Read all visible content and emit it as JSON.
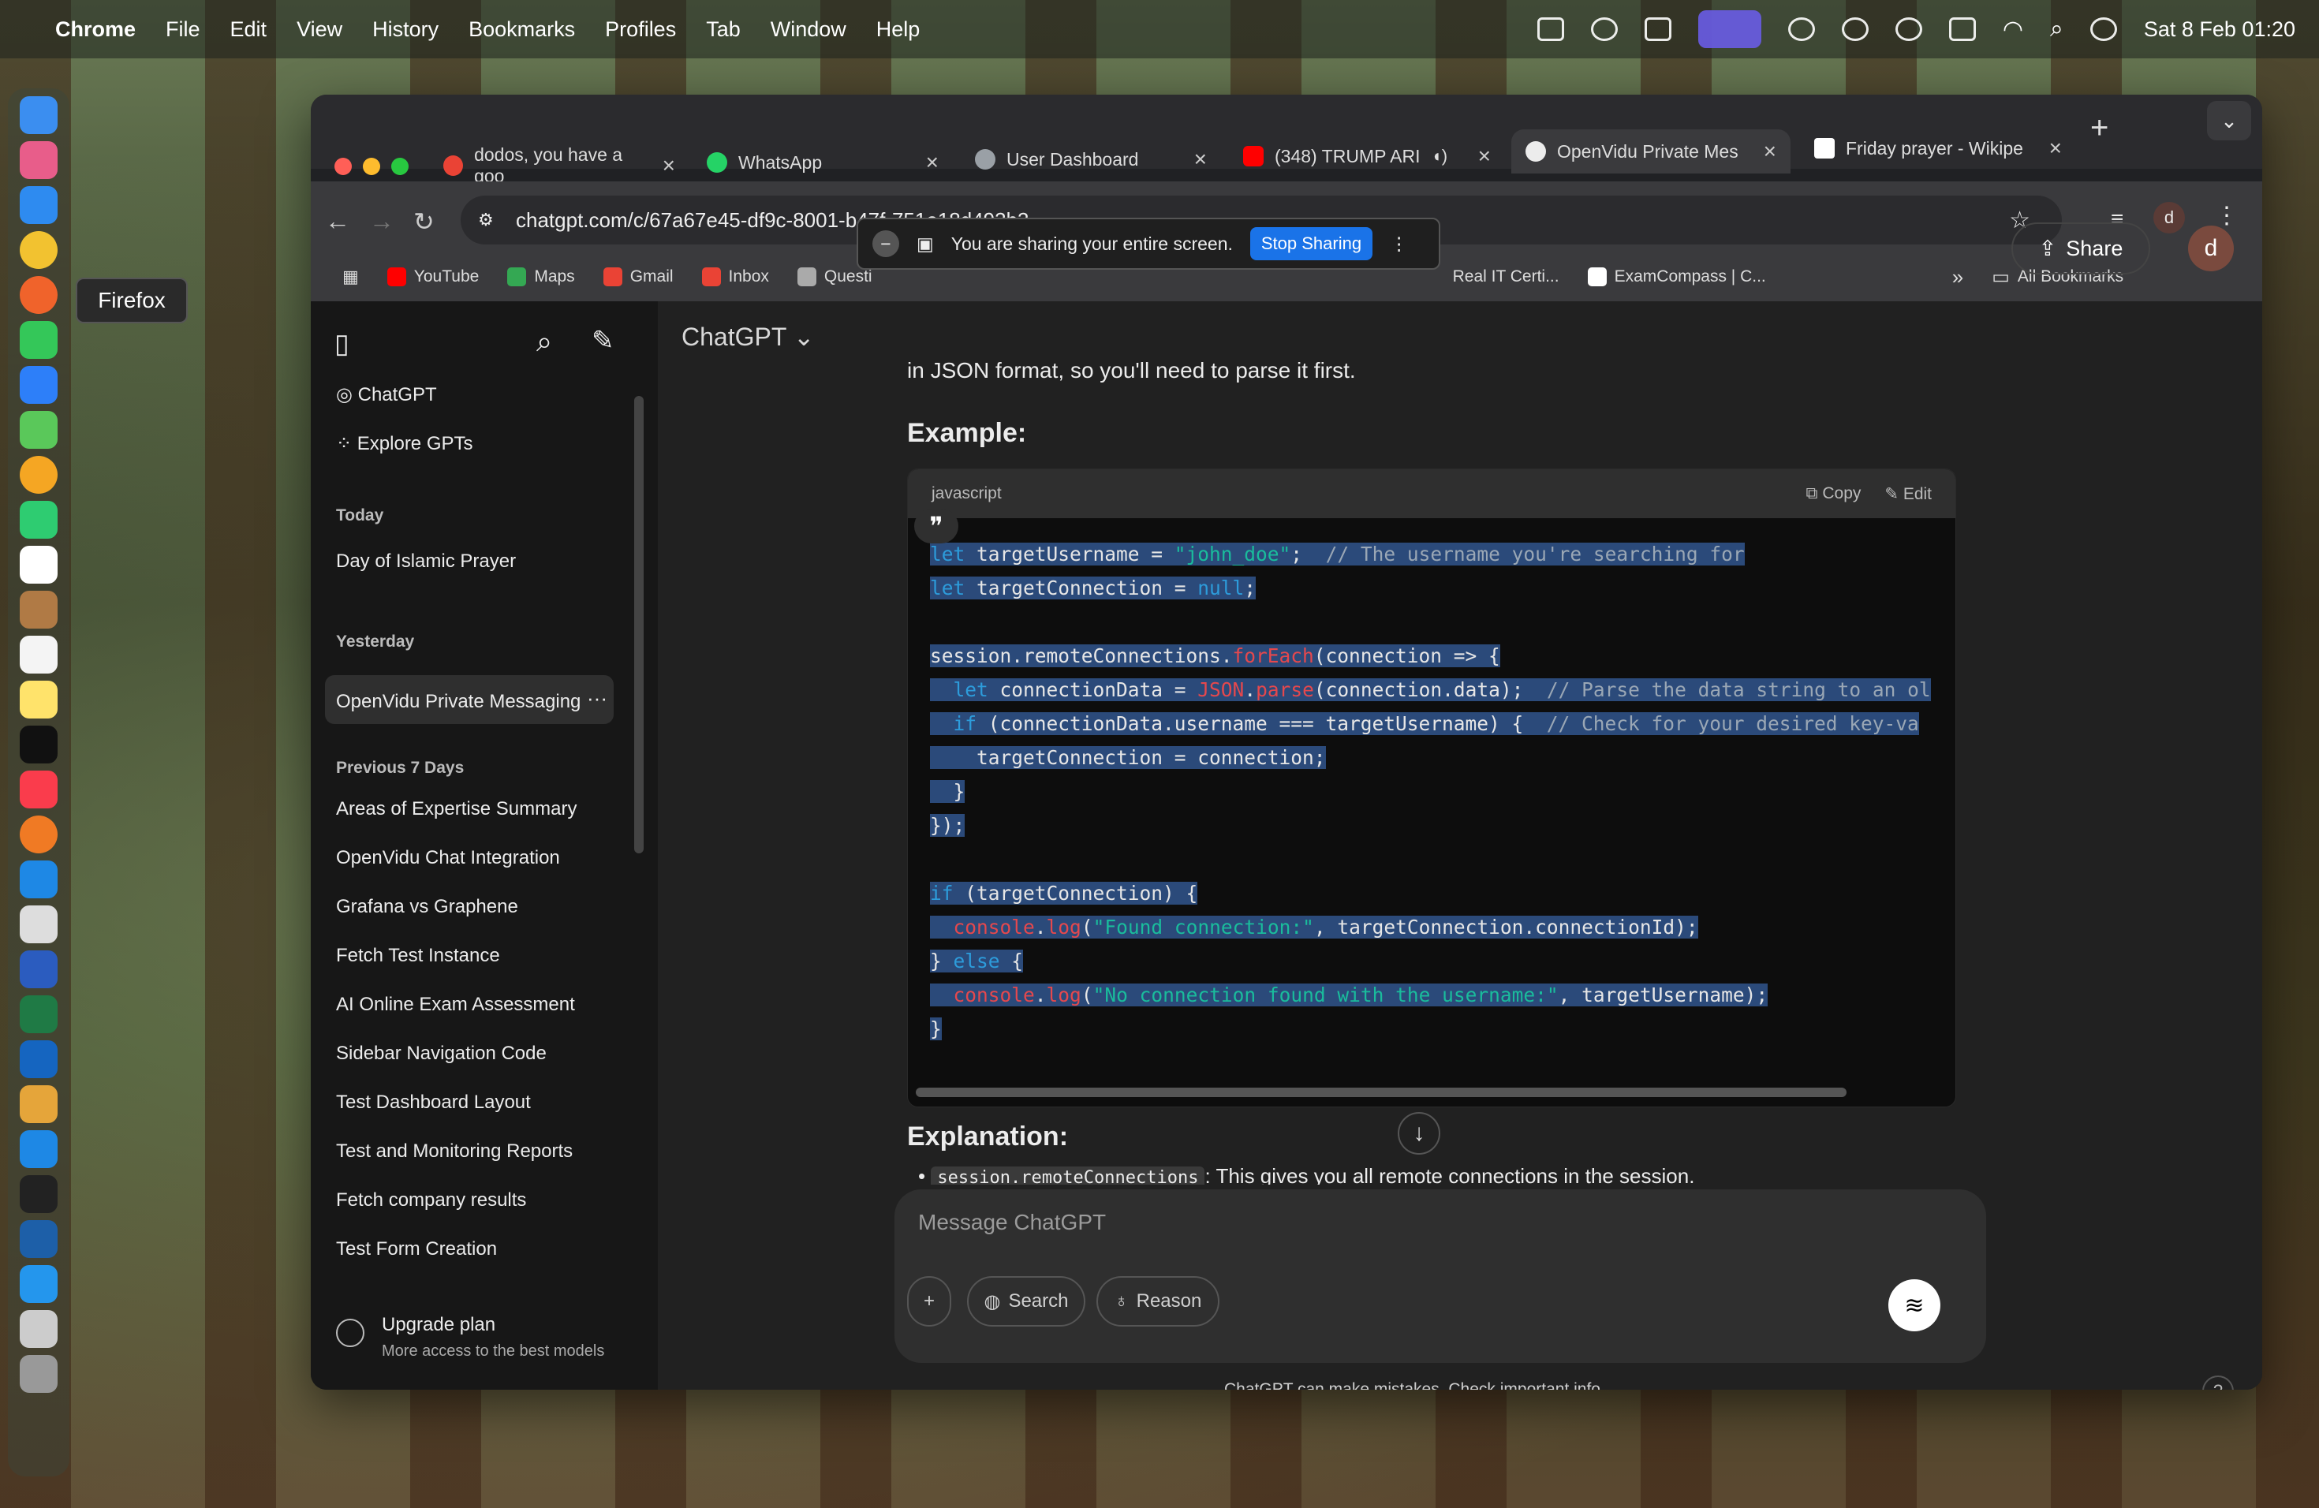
{
  "menubar": {
    "app_name": "Chrome",
    "items": [
      "File",
      "Edit",
      "View",
      "History",
      "Bookmarks",
      "Profiles",
      "Tab",
      "Window",
      "Help"
    ],
    "clock": "Sat 8 Feb  01:20"
  },
  "dock_tooltip": "Firefox",
  "tabs": [
    {
      "title": "dodos, you have a goo",
      "icon_color": "#ea4335"
    },
    {
      "title": "WhatsApp",
      "icon_color": "#25d366"
    },
    {
      "title": "User Dashboard",
      "icon_color": "#9aa0a6"
    },
    {
      "title": "(348) TRUMP ARI",
      "icon_color": "#ff0000"
    },
    {
      "title": "OpenVidu Private Mes",
      "icon_color": "#ececec"
    },
    {
      "title": "Friday prayer - Wikipe",
      "icon_color": "#ffffff"
    }
  ],
  "url": "chatgpt.com/c/67a67e45-df9c-8001-b47f-751e18d493b3",
  "bookmarks": [
    "YouTube",
    "Maps",
    "Gmail",
    "Inbox",
    "Questi",
    "Real IT Certi...",
    "ExamCompass | C..."
  ],
  "all_bookmarks": "All Bookmarks",
  "share_banner": {
    "text": "You are sharing your entire screen.",
    "stop": "Stop Sharing"
  },
  "chatgpt": {
    "header": "ChatGPT",
    "share": "Share",
    "avatar": "d",
    "sidebar": {
      "top_items": [
        "ChatGPT",
        "Explore GPTs"
      ],
      "today_label": "Today",
      "today": [
        "Day of Islamic Prayer"
      ],
      "yesterday_label": "Yesterday",
      "yesterday": [
        "OpenVidu Private Messaging"
      ],
      "prev_label": "Previous 7 Days",
      "prev": [
        "Areas of Expertise Summary",
        "OpenVidu Chat Integration",
        "Grafana vs Graphene",
        "Fetch Test Instance",
        "AI Online Exam Assessment",
        "Sidebar Navigation Code",
        "Test Dashboard Layout",
        "Test and Monitoring Reports",
        "Fetch company results",
        "Test Form Creation"
      ],
      "upgrade_title": "Upgrade plan",
      "upgrade_sub": "More access to the best models"
    },
    "intro_text": "in JSON format, so you'll need to parse it first.",
    "example_heading": "Example:",
    "code_lang": "javascript",
    "copy_label": "Copy",
    "edit_label": "Edit",
    "explanation_heading": "Explanation:",
    "explanation_bullet_code": "session.remoteConnections",
    "explanation_bullet_text": ": This gives you all remote connections in the session.",
    "composer_placeholder": "Message ChatGPT",
    "search_label": "Search",
    "reason_label": "Reason",
    "footer": "ChatGPT can make mistakes. Check important info."
  }
}
